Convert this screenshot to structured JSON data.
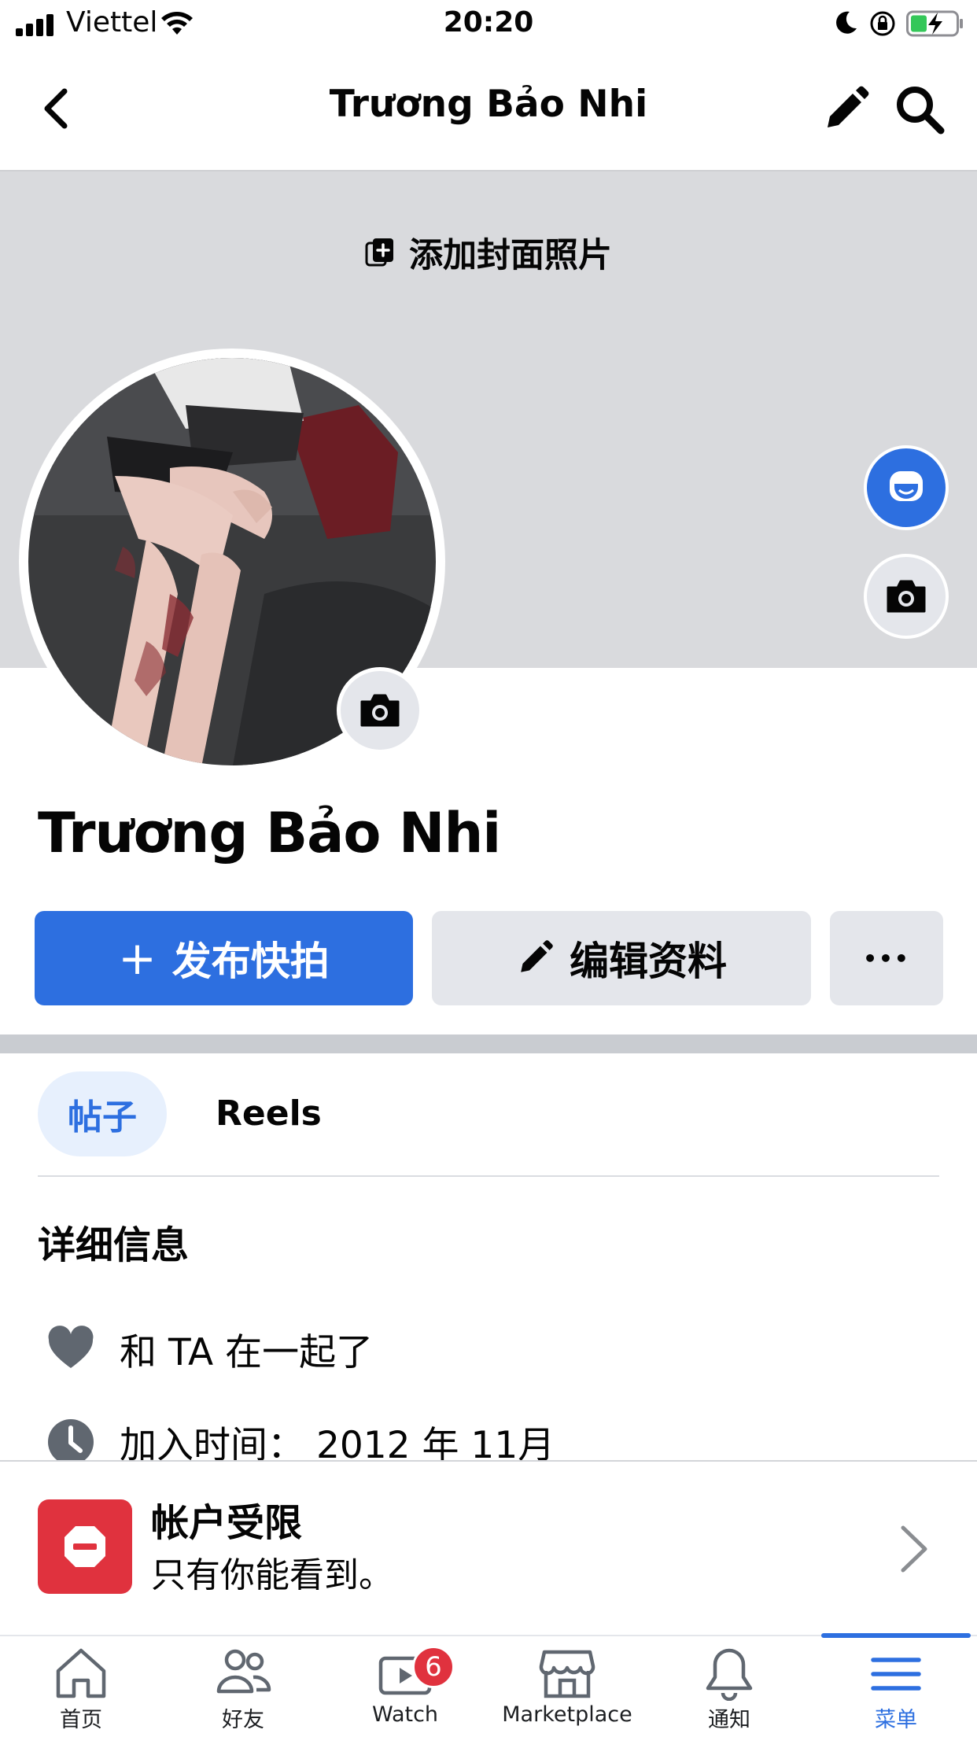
{
  "status_bar": {
    "carrier": "Viettel",
    "time": "20:20",
    "icons": [
      "signal-icon",
      "wifi-icon",
      "moon-icon",
      "rotation-lock-icon",
      "battery-charging-icon"
    ]
  },
  "header": {
    "title": "Trương Bảo Nhi",
    "back_icon": "chevron-left-icon",
    "edit_icon": "pencil-icon",
    "search_icon": "search-icon"
  },
  "cover": {
    "add_cover_label": "添加封面照片"
  },
  "profile": {
    "name": "Trương Bảo Nhi"
  },
  "actions": {
    "snapshot_label": "发布快拍",
    "edit_profile_label": "编辑资料",
    "more_label": "•••"
  },
  "tabs": [
    {
      "label": "帖子",
      "active": true
    },
    {
      "label": "Reels",
      "active": false
    }
  ],
  "details": {
    "title": "详细信息",
    "items": [
      {
        "icon": "heart-icon",
        "text": "和 TA 在一起了"
      },
      {
        "icon": "clock-icon",
        "text": "加入时间： 2012 年 11月"
      }
    ]
  },
  "restricted_banner": {
    "title": "帐户受限",
    "subtitle": "只有你能看到。"
  },
  "tabbar": {
    "items": [
      {
        "label": "首页",
        "icon": "home-icon"
      },
      {
        "label": "好友",
        "icon": "friends-icon"
      },
      {
        "label": "Watch",
        "icon": "watch-icon",
        "badge": "6"
      },
      {
        "label": "Marketplace",
        "icon": "marketplace-icon"
      },
      {
        "label": "通知",
        "icon": "bell-icon"
      },
      {
        "label": "菜单",
        "icon": "menu-icon",
        "active": true
      }
    ]
  },
  "colors": {
    "brand_blue": "#2d6fe0",
    "cover_gray": "#d9dadd",
    "button_gray": "#e4e6eb",
    "alert_red": "#e0323e"
  }
}
